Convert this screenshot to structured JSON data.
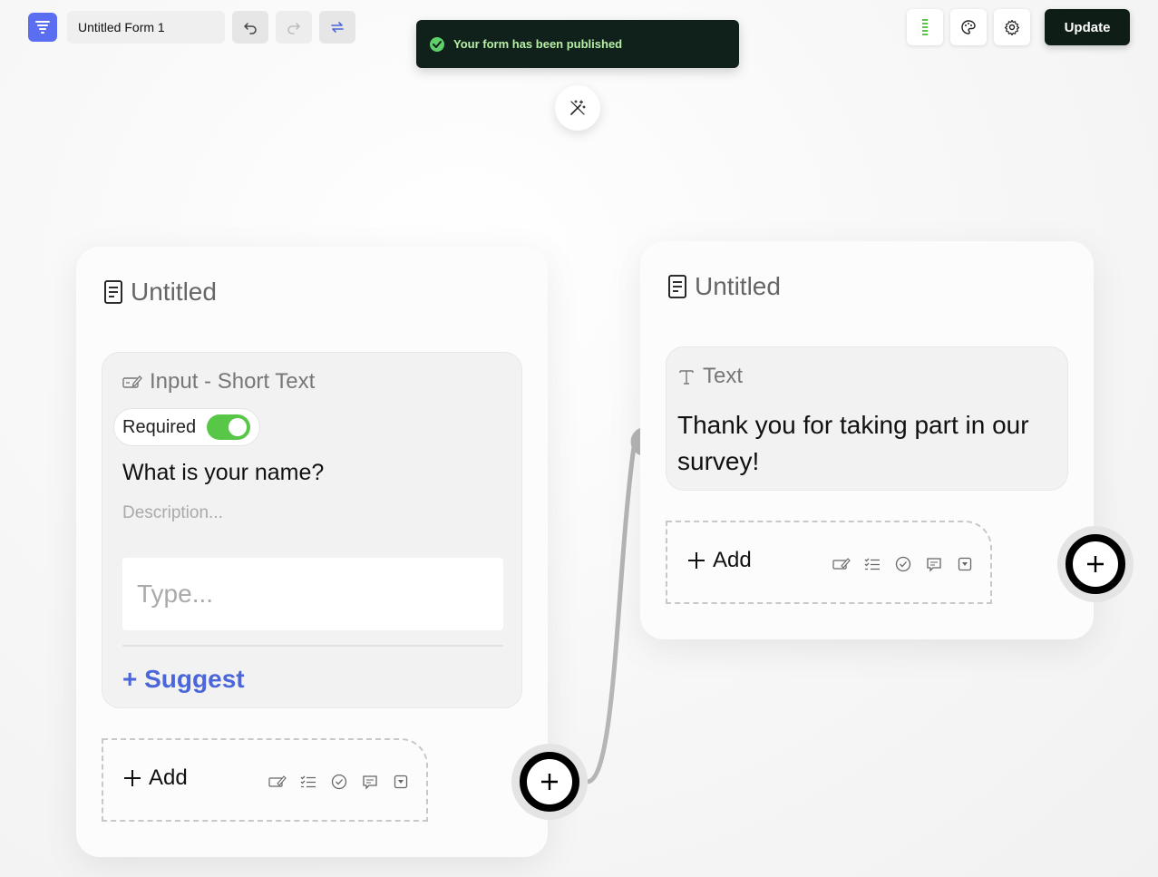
{
  "header": {
    "form_title": "Untitled Form 1",
    "update_label": "Update"
  },
  "toast": {
    "message": "Your form has been published"
  },
  "colors": {
    "accent": "#5b6df0",
    "toast_bg": "#10201a",
    "toast_text": "#b7f0a6",
    "toggle_on": "#58c748",
    "suggest": "#4a66d9"
  },
  "cards": [
    {
      "title": "Untitled",
      "block": {
        "type_label": "Input - Short Text",
        "required_label": "Required",
        "required": true,
        "question": "What is your name?",
        "description_placeholder": "Description...",
        "input_placeholder": "Type...",
        "suggest_label": "+ Suggest"
      },
      "add_label": "Add"
    },
    {
      "title": "Untitled",
      "block": {
        "type_label": "Text",
        "content": "Thank you for taking part in our survey!"
      },
      "add_label": "Add"
    }
  ],
  "add_icons": [
    "input-icon",
    "checklist-icon",
    "check-circle-icon",
    "comment-icon",
    "dropdown-icon"
  ]
}
